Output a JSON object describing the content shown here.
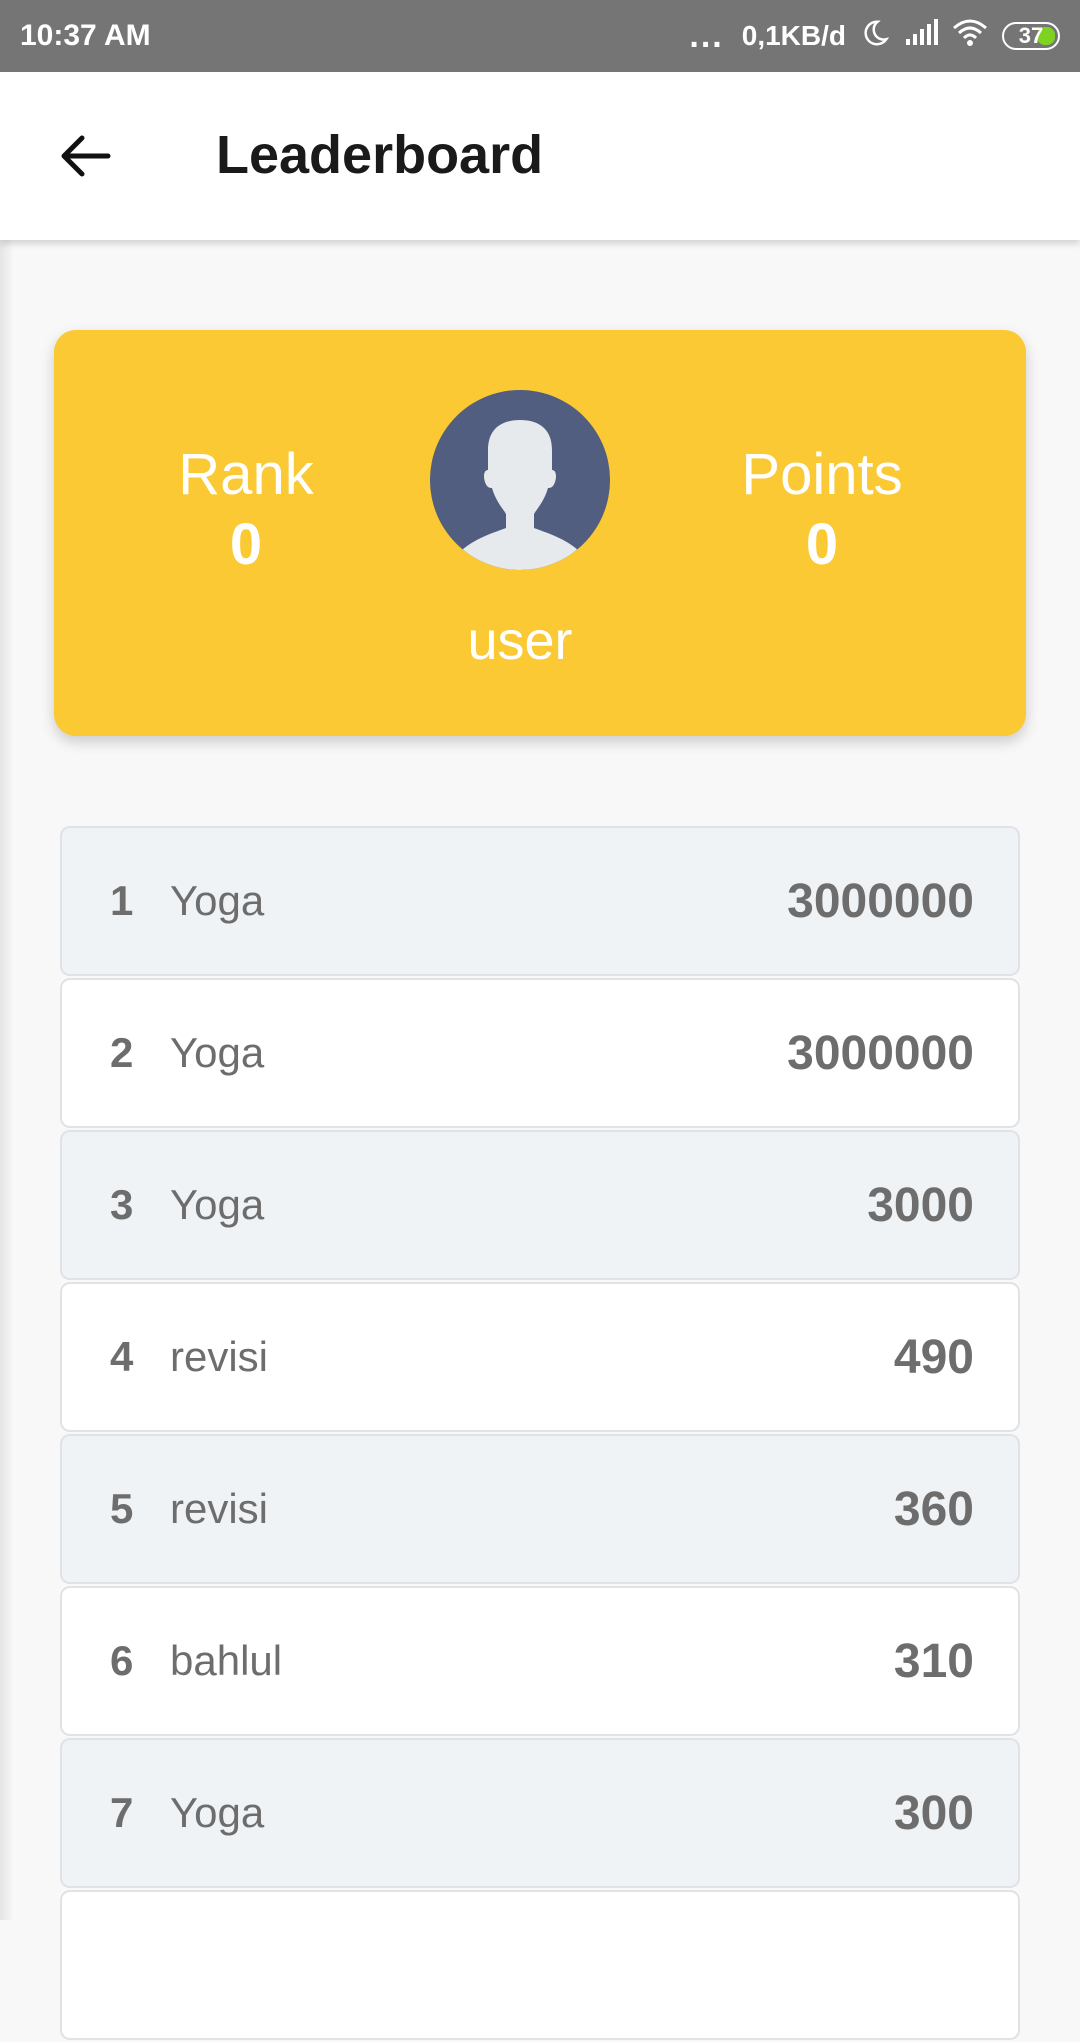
{
  "status_bar": {
    "time": "10:37 AM",
    "dots": "...",
    "net_speed": "0,1KB/d",
    "battery": "37"
  },
  "toolbar": {
    "title": "Leaderboard"
  },
  "profile": {
    "rank_label": "Rank",
    "rank_value": "0",
    "points_label": "Points",
    "points_value": "0",
    "username": "user"
  },
  "leaderboard": [
    {
      "rank": "1",
      "name": "Yoga",
      "score": "3000000"
    },
    {
      "rank": "2",
      "name": "Yoga",
      "score": "3000000"
    },
    {
      "rank": "3",
      "name": "Yoga",
      "score": "3000"
    },
    {
      "rank": "4",
      "name": "revisi",
      "score": "490"
    },
    {
      "rank": "5",
      "name": "revisi",
      "score": "360"
    },
    {
      "rank": "6",
      "name": "bahlul",
      "score": "310"
    },
    {
      "rank": "7",
      "name": "Yoga",
      "score": "300"
    },
    {
      "rank": "",
      "name": "",
      "score": ""
    }
  ],
  "colors": {
    "card": "#fbc934",
    "avatar_bg": "#525e7f",
    "row_shaded": "#eff3f6",
    "status_bar": "#757575"
  }
}
